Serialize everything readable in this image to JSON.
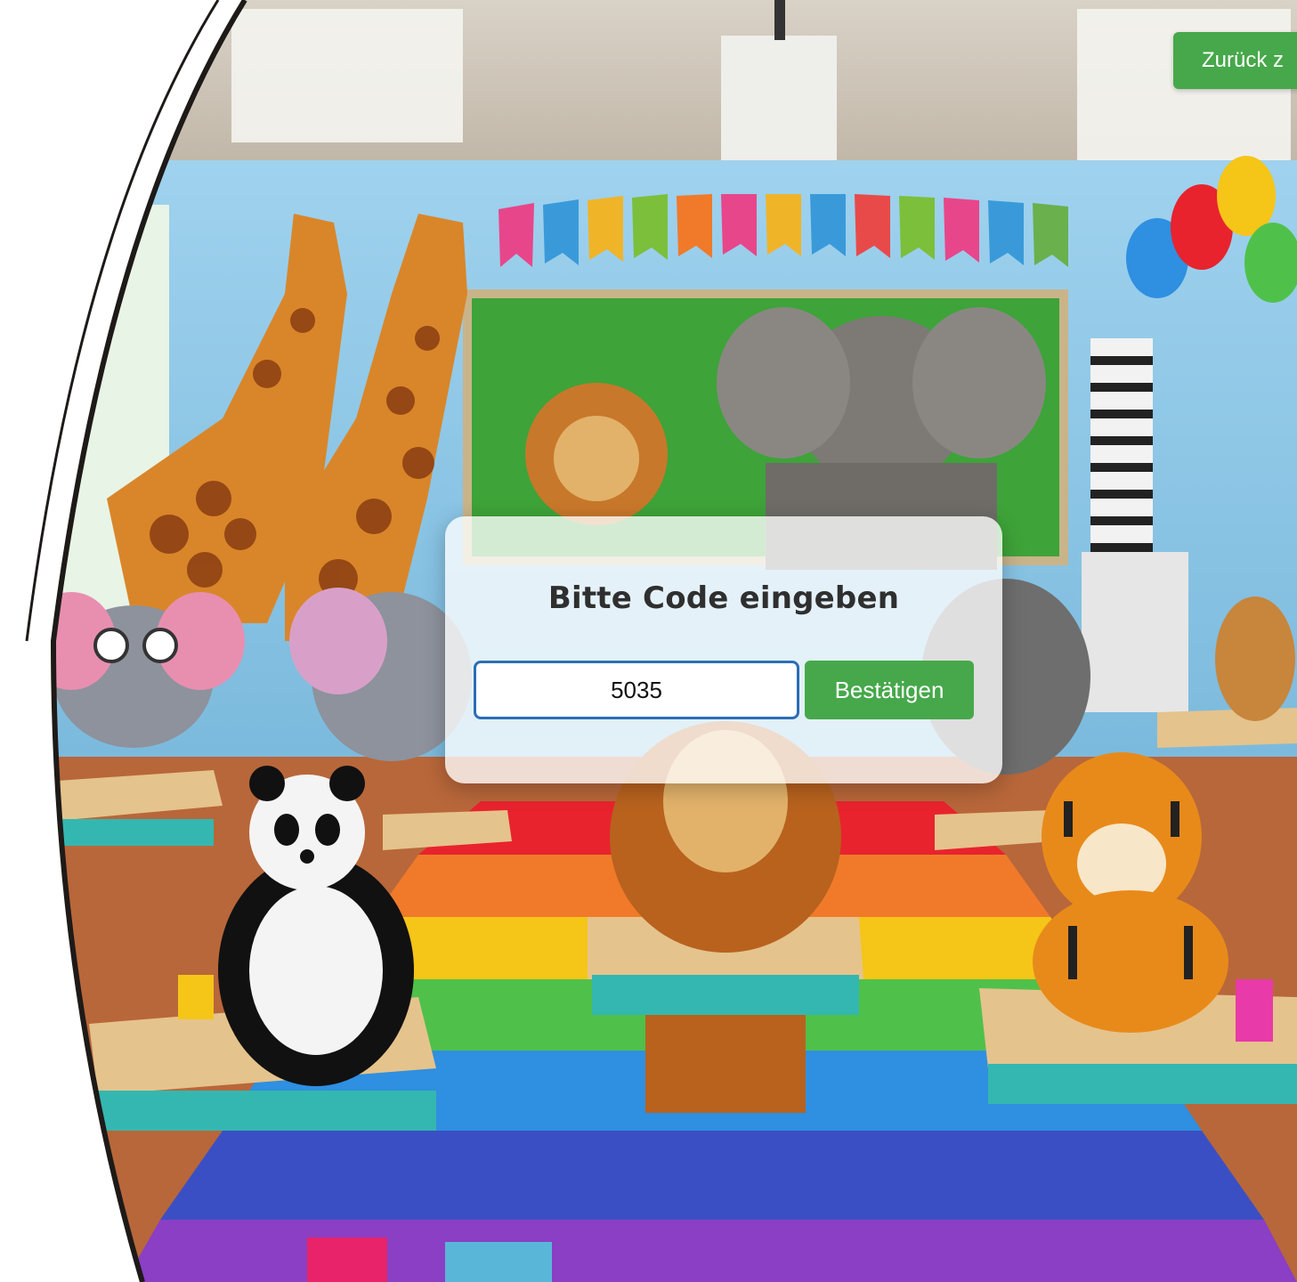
{
  "header": {
    "back_label": "Zurück z"
  },
  "dialog": {
    "title": "Bitte Code eingeben",
    "code_value": "5035",
    "confirm_label": "Bestätigen"
  },
  "colors": {
    "accent_green": "#46a84a",
    "input_border": "#2a6db6"
  },
  "background": {
    "scene": "classroom-with-animals-illustration"
  }
}
